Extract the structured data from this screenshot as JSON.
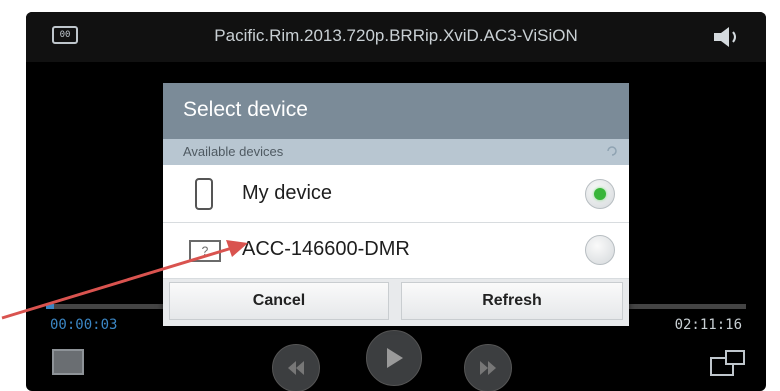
{
  "player": {
    "title": "Pacific.Rim.2013.720p.BRRip.XviD.AC3-ViSiON",
    "time_elapsed": "00:00:03",
    "time_total": "02:11:16",
    "progress_fraction": 0.005,
    "cc_icon_text": "00"
  },
  "dialog": {
    "title": "Select device",
    "section_label": "Available devices",
    "devices": [
      {
        "label": "My device",
        "icon": "phone-icon",
        "selected": true
      },
      {
        "label": "ACC-146600-DMR",
        "icon": "unknown-device-icon",
        "icon_text": "?",
        "selected": false
      }
    ],
    "cancel_label": "Cancel",
    "refresh_label": "Refresh"
  },
  "colors": {
    "accent": "#3b86c4",
    "radio_on": "#39b53a",
    "dialog_header": "#7b8b98",
    "arrow": "#d9534f"
  }
}
